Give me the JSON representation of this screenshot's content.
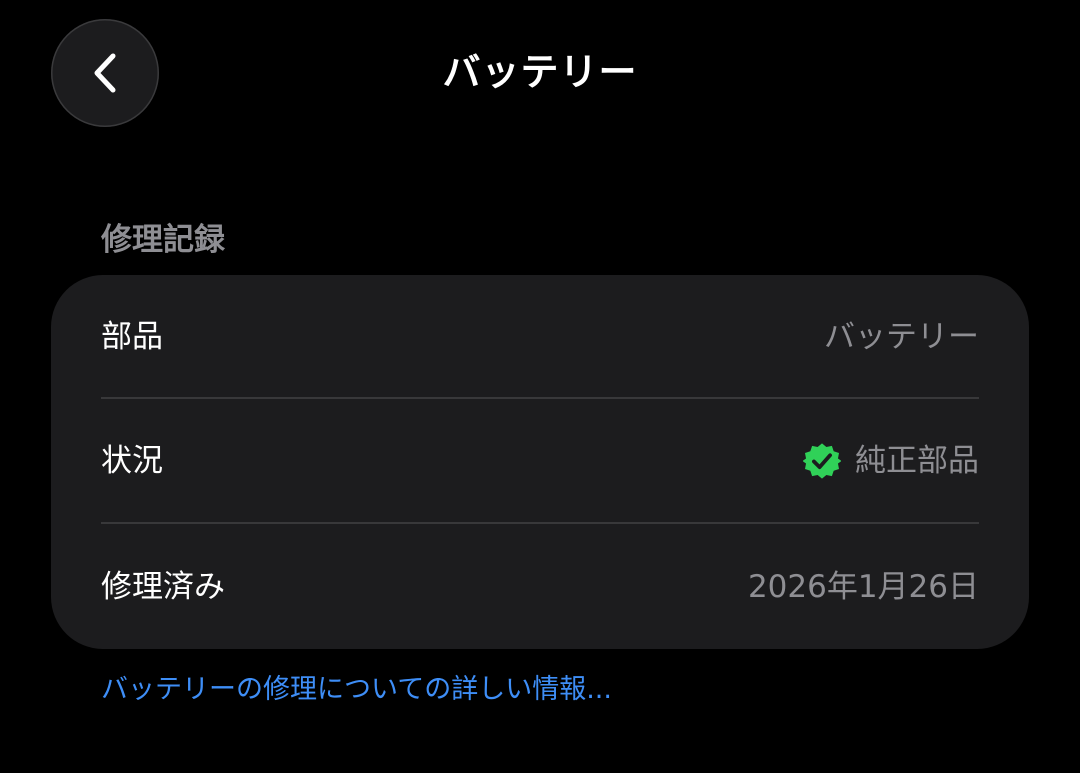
{
  "header": {
    "title": "バッテリー",
    "back_icon": "chevron-left-icon"
  },
  "repair_record": {
    "section_title": "修理記録",
    "rows": [
      {
        "label": "部品",
        "value": "バッテリー"
      },
      {
        "label": "状況",
        "value": "純正部品",
        "icon": "verified-badge-icon"
      },
      {
        "label": "修理済み",
        "value": "2026年1月26日"
      }
    ]
  },
  "footer": {
    "link_text": "バッテリーの修理についての詳しい情報..."
  },
  "colors": {
    "background": "#000000",
    "card": "#1c1c1e",
    "secondary_text": "#8e8e93",
    "link": "#3e8ef7",
    "verified_badge": "#30d158"
  }
}
